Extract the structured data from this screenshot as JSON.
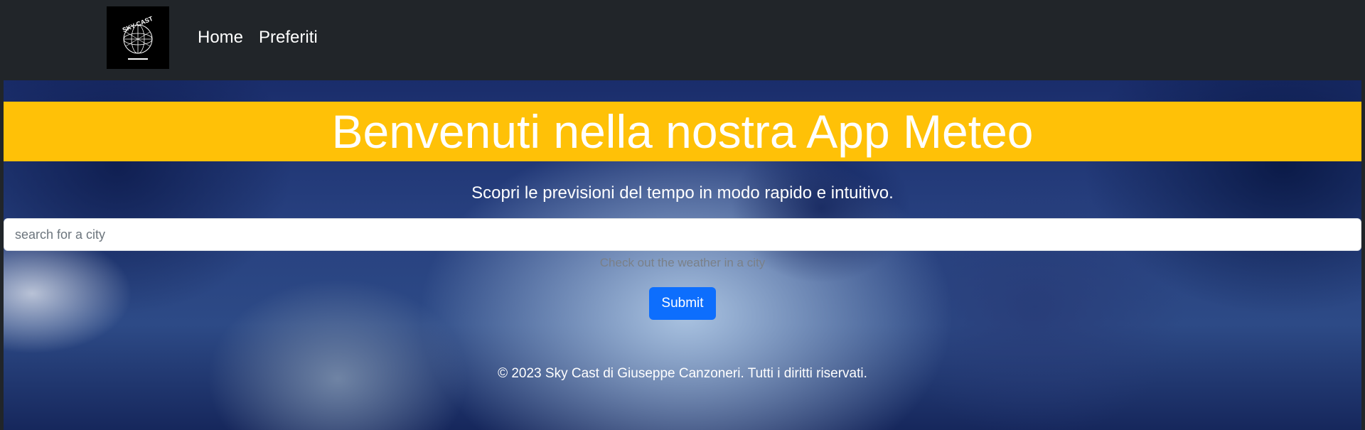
{
  "navbar": {
    "logo_text": "SKY CAST",
    "links": [
      {
        "label": "Home"
      },
      {
        "label": "Preferiti"
      }
    ]
  },
  "hero": {
    "title": "Benvenuti nella nostra App Meteo",
    "subtitle": "Scopri le previsioni del tempo in modo rapido e intuitivo."
  },
  "search": {
    "value": "",
    "placeholder": "search for a city",
    "helper_text": "Check out the weather in a city",
    "submit_label": "Submit"
  },
  "footer": {
    "text": "© 2023 Sky Cast di Giuseppe Canzoneri. Tutti i diritti riservati."
  },
  "colors": {
    "navbar_bg": "#212529",
    "banner_bg": "#ffc107",
    "button_bg": "#0d6efd",
    "text_light": "#ffffff"
  }
}
